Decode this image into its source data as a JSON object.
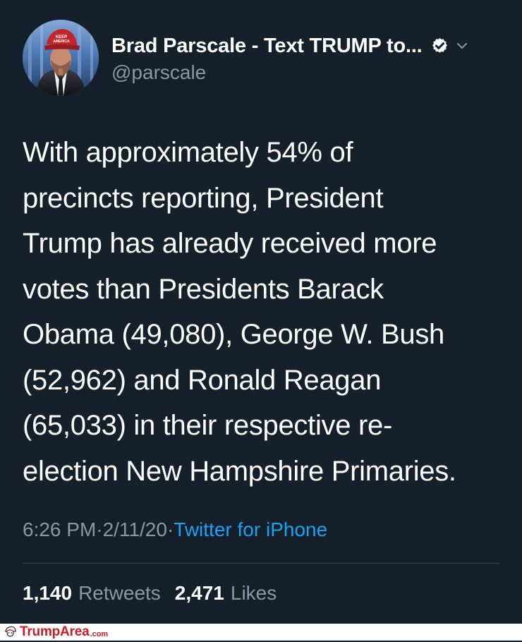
{
  "account": {
    "display_name": "Brad Parscale - Text TRUMP to...",
    "handle": "@parscale",
    "verified_icon": "verified-badge-icon",
    "menu_icon": "chevron-down-icon"
  },
  "tweet": {
    "text": "With approximately 54% of\nprecincts reporting, President\nTrump has already received more\nvotes than Presidents Barack\nObama (49,080), George W. Bush\n(52,962) and Ronald Reagan\n(65,033) in their respective re-\nelection New Hampshire Primaries.",
    "time": "6:26 PM",
    "separator_1": " · ",
    "date": "2/11/20",
    "separator_2": " · ",
    "source": "Twitter for iPhone"
  },
  "stats": {
    "retweets_count": "1,140",
    "retweets_label": "Retweets",
    "likes_count": "2,471",
    "likes_label": "Likes"
  },
  "watermark": {
    "brand": "TrumpArea",
    "domain": ".com",
    "icon": "trump-area-logo-icon"
  },
  "colors": {
    "background": "#15202b",
    "primary_text": "#ffffff",
    "secondary_text": "#8899a6",
    "link": "#1da1f2",
    "divider": "#38444d",
    "watermark_red": "#c61f25"
  }
}
